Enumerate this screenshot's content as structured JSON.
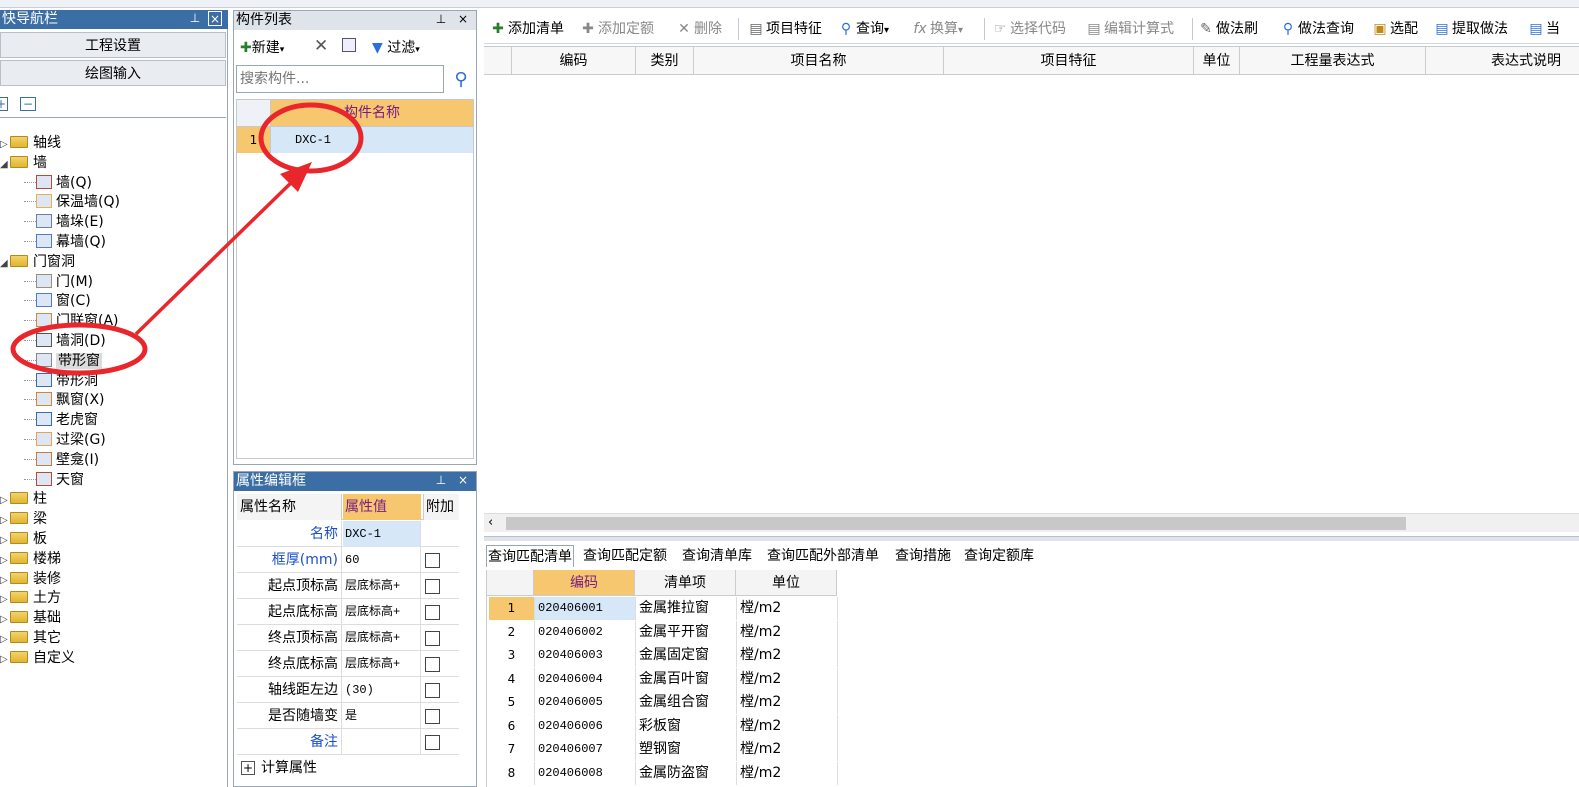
{
  "nav_panel": {
    "title": "快导航栏",
    "pin": "ᴾ",
    "close": "×",
    "btn_project_settings": "工程设置",
    "btn_drawing_input": "绘图输入",
    "tree": [
      {
        "label": "轴线",
        "level": 0,
        "expanded": false
      },
      {
        "label": "墙",
        "level": 0,
        "expanded": true
      },
      {
        "label": "墙(Q)",
        "level": 1
      },
      {
        "label": "保温墙(Q)",
        "level": 1
      },
      {
        "label": "墙垛(E)",
        "level": 1
      },
      {
        "label": "幕墙(Q)",
        "level": 1
      },
      {
        "label": "门窗洞",
        "level": 0,
        "expanded": true
      },
      {
        "label": "门(M)",
        "level": 1
      },
      {
        "label": "窗(C)",
        "level": 1
      },
      {
        "label": "门联窗(A)",
        "level": 1
      },
      {
        "label": "墙洞(D)",
        "level": 1
      },
      {
        "label": "带形窗",
        "level": 1,
        "selected": true
      },
      {
        "label": "带形洞",
        "level": 1
      },
      {
        "label": "飘窗(X)",
        "level": 1
      },
      {
        "label": "老虎窗",
        "level": 1
      },
      {
        "label": "过梁(G)",
        "level": 1
      },
      {
        "label": "壁龛(I)",
        "level": 1
      },
      {
        "label": "天窗",
        "level": 1
      },
      {
        "label": "柱",
        "level": 0,
        "expanded": false
      },
      {
        "label": "梁",
        "level": 0,
        "expanded": false
      },
      {
        "label": "板",
        "level": 0,
        "expanded": false
      },
      {
        "label": "楼梯",
        "level": 0,
        "expanded": false
      },
      {
        "label": "装修",
        "level": 0,
        "expanded": false
      },
      {
        "label": "土方",
        "level": 0,
        "expanded": false
      },
      {
        "label": "基础",
        "level": 0,
        "expanded": false
      },
      {
        "label": "其它",
        "level": 0,
        "expanded": false
      },
      {
        "label": "自定义",
        "level": 0,
        "expanded": false
      }
    ]
  },
  "component_list": {
    "title": "构件列表",
    "new_label": "新建",
    "filter_label": "过滤",
    "search_placeholder": "搜索构件...",
    "column_header": "构件名称",
    "rows": [
      {
        "index": "1",
        "name": "DXC-1"
      }
    ]
  },
  "property_panel": {
    "title": "属性编辑框",
    "headers": {
      "name": "属性名称",
      "value": "属性值",
      "extra": "附加"
    },
    "rows": [
      {
        "name": "名称",
        "value": "DXC-1",
        "blue": true,
        "checkbox": false
      },
      {
        "name": "框厚(mm)",
        "value": "60",
        "blue": true,
        "checkbox": true
      },
      {
        "name": "起点顶标高",
        "value": "层底标高+",
        "blue": false,
        "checkbox": true
      },
      {
        "name": "起点底标高",
        "value": "层底标高+",
        "blue": false,
        "checkbox": true
      },
      {
        "name": "终点顶标高",
        "value": "层底标高+",
        "blue": false,
        "checkbox": true
      },
      {
        "name": "终点底标高",
        "value": "层底标高+",
        "blue": false,
        "checkbox": true
      },
      {
        "name": "轴线距左边",
        "value": "(30)",
        "blue": false,
        "checkbox": true
      },
      {
        "name": "是否随墙变",
        "value": "是",
        "blue": false,
        "checkbox": true
      },
      {
        "name": "备注",
        "value": "",
        "blue": true,
        "checkbox": true
      }
    ],
    "calc_group": "计算属性"
  },
  "toolbar": {
    "add_list": "添加清单",
    "add_quota": "添加定额",
    "delete": "删除",
    "item_feature": "项目特征",
    "query": "查询",
    "convert": "换算",
    "select_code": "选择代码",
    "edit_formula": "编辑计算式",
    "method_brush": "做法刷",
    "method_query": "做法查询",
    "match": "选配",
    "extract_method": "提取做法",
    "current": "当"
  },
  "main_grid": {
    "headers": [
      "编码",
      "类别",
      "项目名称",
      "项目特征",
      "单位",
      "工程量表达式",
      "表达式说明"
    ]
  },
  "bottom_tabs": [
    "查询匹配清单",
    "查询匹配定额",
    "查询清单库",
    "查询匹配外部清单",
    "查询措施",
    "查询定额库"
  ],
  "match_table": {
    "headers": [
      "编码",
      "清单项",
      "单位"
    ],
    "rows": [
      {
        "index": "1",
        "code": "020406001",
        "item": "金属推拉窗",
        "unit": "樘/m2"
      },
      {
        "index": "2",
        "code": "020406002",
        "item": "金属平开窗",
        "unit": "樘/m2"
      },
      {
        "index": "3",
        "code": "020406003",
        "item": "金属固定窗",
        "unit": "樘/m2"
      },
      {
        "index": "4",
        "code": "020406004",
        "item": "金属百叶窗",
        "unit": "樘/m2"
      },
      {
        "index": "5",
        "code": "020406005",
        "item": "金属组合窗",
        "unit": "樘/m2"
      },
      {
        "index": "6",
        "code": "020406006",
        "item": "彩板窗",
        "unit": "樘/m2"
      },
      {
        "index": "7",
        "code": "020406007",
        "item": "塑钢窗",
        "unit": "樘/m2"
      },
      {
        "index": "8",
        "code": "020406008",
        "item": "金属防盗窗",
        "unit": "樘/m2"
      }
    ]
  },
  "colors": {
    "title_bar": "#3a6ea5",
    "panel_bg": "#dfe4ea",
    "header_orange": "#f6c76e",
    "selection": "#d6e8f7",
    "annotation_red": "#e8262b",
    "label_blue": "#1a4fd0"
  }
}
